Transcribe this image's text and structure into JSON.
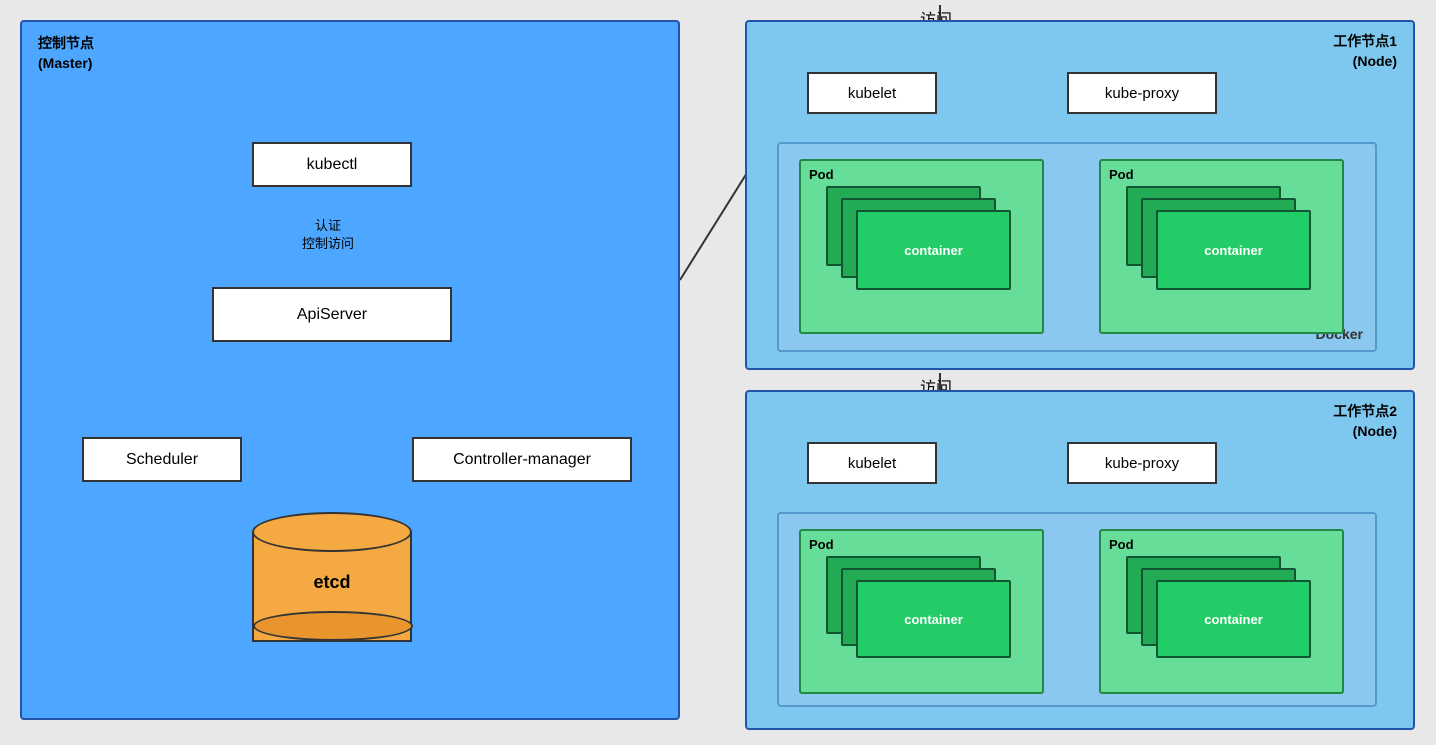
{
  "master": {
    "title_line1": "控制节点",
    "title_line2": "(Master)",
    "kubectl": "kubectl",
    "auth_label": "认证\n控制访问",
    "apiserver": "ApiServer",
    "scheduler": "Scheduler",
    "controller": "Controller-manager",
    "etcd": "etcd"
  },
  "worker1": {
    "title_line1": "工作节点1",
    "title_line2": "(Node)",
    "access": "访问",
    "kubelet": "kubelet",
    "kube_proxy": "kube-proxy",
    "docker_label": "Docker",
    "pod1_label": "Pod",
    "pod2_label": "Pod",
    "container1": "container",
    "container2": "container"
  },
  "worker2": {
    "title_line1": "工作节点2",
    "title_line2": "(Node)",
    "access": "访问",
    "kubelet": "kubelet",
    "kube_proxy": "kube-proxy",
    "pod1_label": "Pod",
    "pod2_label": "Pod",
    "container1": "container",
    "container2": "container"
  }
}
